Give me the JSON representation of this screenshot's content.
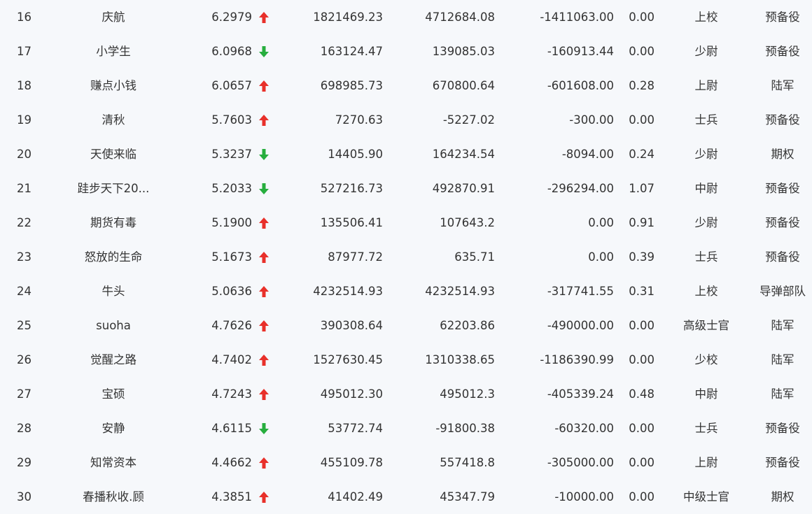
{
  "colors": {
    "up": "#e8302a",
    "down": "#27ae3e",
    "text": "#333333",
    "background": "#f6f8fb"
  },
  "rows": [
    {
      "rank": "16",
      "name": "庆航",
      "score": "6.2979",
      "trend": "up",
      "v1": "1821469.23",
      "v2": "4712684.08",
      "v3": "-1411063.00",
      "v4": "0.00",
      "level": "上校",
      "category": "预备役"
    },
    {
      "rank": "17",
      "name": "小学生",
      "score": "6.0968",
      "trend": "down",
      "v1": "163124.47",
      "v2": "139085.03",
      "v3": "-160913.44",
      "v4": "0.00",
      "level": "少尉",
      "category": "预备役"
    },
    {
      "rank": "18",
      "name": "赚点小钱",
      "score": "6.0657",
      "trend": "up",
      "v1": "698985.73",
      "v2": "670800.64",
      "v3": "-601608.00",
      "v4": "0.28",
      "level": "上尉",
      "category": "陆军"
    },
    {
      "rank": "19",
      "name": "清秋",
      "score": "5.7603",
      "trend": "up",
      "v1": "7270.63",
      "v2": "-5227.02",
      "v3": "-300.00",
      "v4": "0.00",
      "level": "士兵",
      "category": "预备役"
    },
    {
      "rank": "20",
      "name": "天使来临",
      "score": "5.3237",
      "trend": "down",
      "v1": "14405.90",
      "v2": "164234.54",
      "v3": "-8094.00",
      "v4": "0.24",
      "level": "少尉",
      "category": "期权"
    },
    {
      "rank": "21",
      "name": "跬步天下20...",
      "score": "5.2033",
      "trend": "down",
      "v1": "527216.73",
      "v2": "492870.91",
      "v3": "-296294.00",
      "v4": "1.07",
      "level": "中尉",
      "category": "预备役"
    },
    {
      "rank": "22",
      "name": "期货有毒",
      "score": "5.1900",
      "trend": "up",
      "v1": "135506.41",
      "v2": "107643.2",
      "v3": "0.00",
      "v4": "0.91",
      "level": "少尉",
      "category": "预备役"
    },
    {
      "rank": "23",
      "name": "怒放的生命",
      "score": "5.1673",
      "trend": "up",
      "v1": "87977.72",
      "v2": "635.71",
      "v3": "0.00",
      "v4": "0.39",
      "level": "士兵",
      "category": "预备役"
    },
    {
      "rank": "24",
      "name": "牛头",
      "score": "5.0636",
      "trend": "up",
      "v1": "4232514.93",
      "v2": "4232514.93",
      "v3": "-317741.55",
      "v4": "0.31",
      "level": "上校",
      "category": "导弹部队"
    },
    {
      "rank": "25",
      "name": "suoha",
      "score": "4.7626",
      "trend": "up",
      "v1": "390308.64",
      "v2": "62203.86",
      "v3": "-490000.00",
      "v4": "0.00",
      "level": "高级士官",
      "category": "陆军"
    },
    {
      "rank": "26",
      "name": "觉醒之路",
      "score": "4.7402",
      "trend": "up",
      "v1": "1527630.45",
      "v2": "1310338.65",
      "v3": "-1186390.99",
      "v4": "0.00",
      "level": "少校",
      "category": "陆军"
    },
    {
      "rank": "27",
      "name": "宝硕",
      "score": "4.7243",
      "trend": "up",
      "v1": "495012.30",
      "v2": "495012.3",
      "v3": "-405339.24",
      "v4": "0.48",
      "level": "中尉",
      "category": "陆军"
    },
    {
      "rank": "28",
      "name": "安静",
      "score": "4.6115",
      "trend": "down",
      "v1": "53772.74",
      "v2": "-91800.38",
      "v3": "-60320.00",
      "v4": "0.00",
      "level": "士兵",
      "category": "预备役"
    },
    {
      "rank": "29",
      "name": "知常资本",
      "score": "4.4662",
      "trend": "up",
      "v1": "455109.78",
      "v2": "557418.8",
      "v3": "-305000.00",
      "v4": "0.00",
      "level": "上尉",
      "category": "预备役"
    },
    {
      "rank": "30",
      "name": "春播秋收.顾",
      "score": "4.3851",
      "trend": "up",
      "v1": "41402.49",
      "v2": "45347.79",
      "v3": "-10000.00",
      "v4": "0.00",
      "level": "中级士官",
      "category": "期权"
    }
  ]
}
